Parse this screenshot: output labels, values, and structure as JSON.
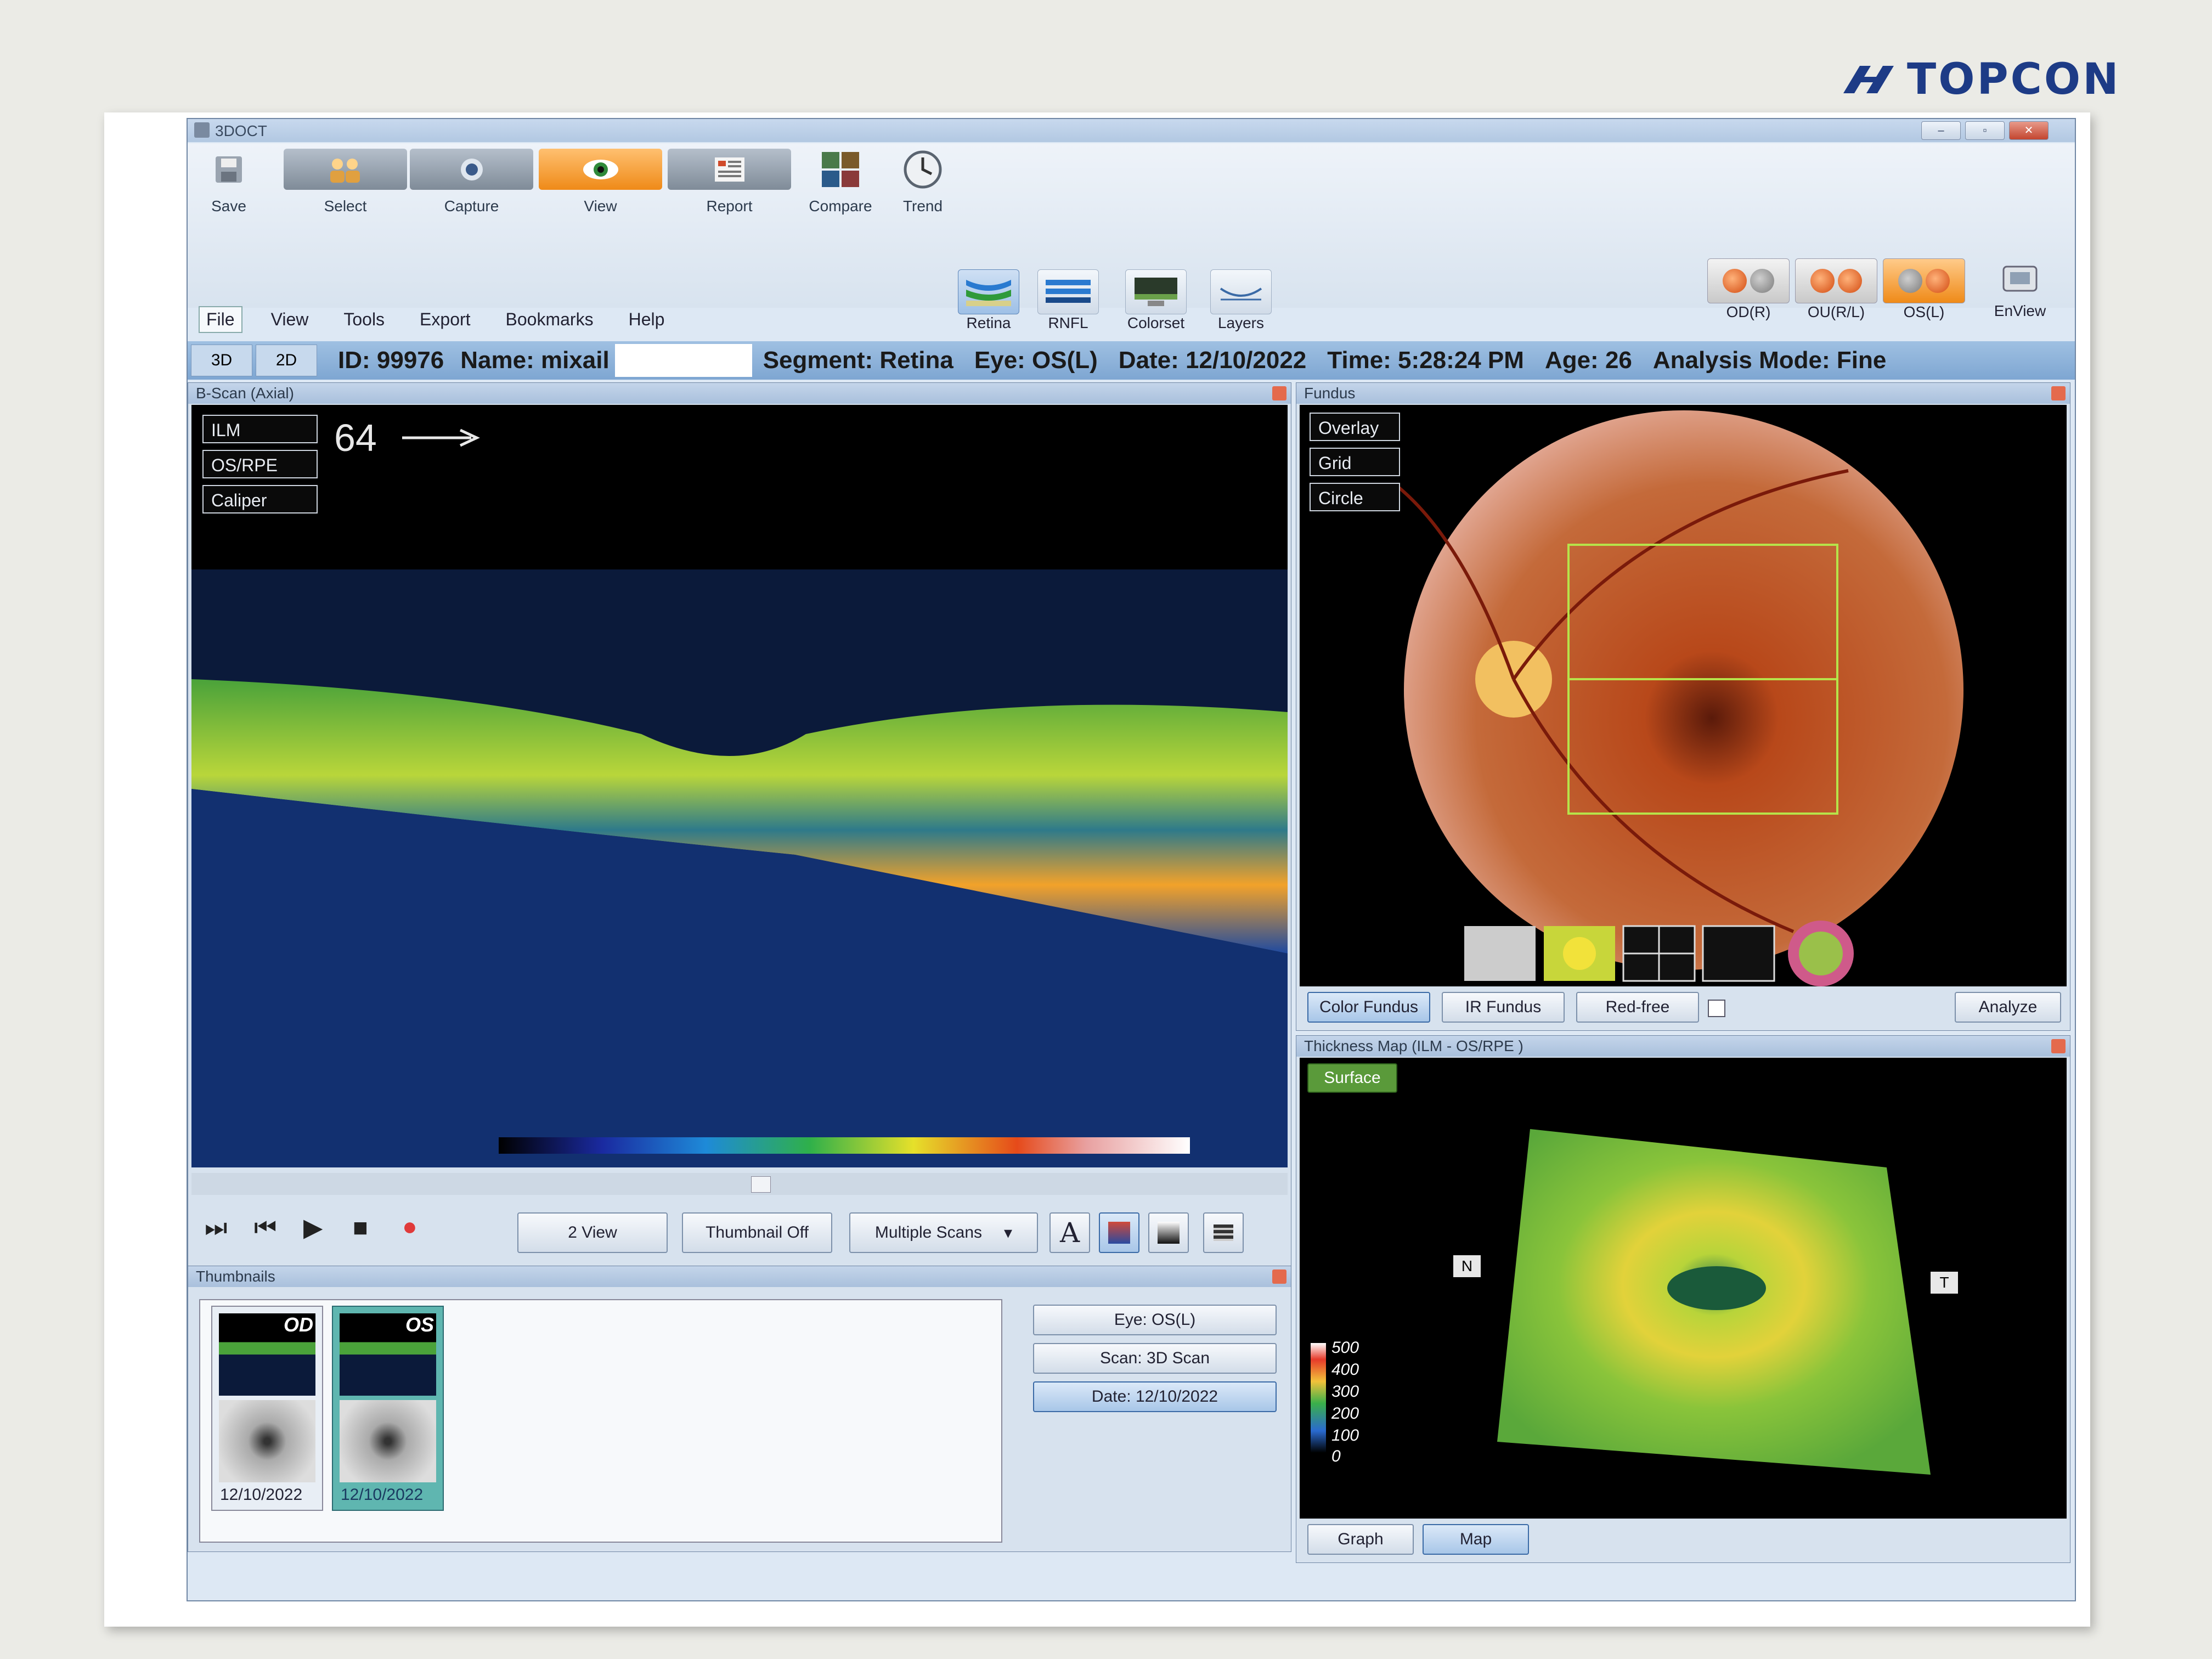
{
  "brand": {
    "name": "TOPCON",
    "color": "#1d3b86"
  },
  "window": {
    "title": "3DOCT",
    "controls": [
      "–",
      "▫",
      "✕"
    ]
  },
  "toolbar": {
    "save": "Save",
    "select": "Select",
    "capture": "Capture",
    "view": "View",
    "report": "Report",
    "compare": "Compare",
    "trend": "Trend"
  },
  "viewbar": {
    "retina": "Retina",
    "rnfl": "RNFL",
    "colorset": "Colorset",
    "layers": "Layers"
  },
  "eyes": {
    "od": "OD(R)",
    "ou": "OU(R/L)",
    "os": "OS(L)",
    "enview": "EnView"
  },
  "menu": [
    "File",
    "View",
    "Tools",
    "Export",
    "Bookmarks",
    "Help"
  ],
  "tabs": {
    "t3d": "3D",
    "t2d": "2D"
  },
  "info": {
    "id": "ID: 99976",
    "name": "Name: mixail",
    "segment": "Segment: Retina",
    "eye": "Eye: OS(L)",
    "date": "Date: 12/10/2022",
    "time": "Time: 5:28:24 PM",
    "age": "Age: 26",
    "mode": "Analysis Mode: Fine"
  },
  "bscan": {
    "title": "B-Scan (Axial)",
    "frame": "64",
    "overlays": [
      "ILM",
      "OS/RPE",
      "Caliper"
    ],
    "view2": "2 View",
    "thumb": "Thumbnail Off",
    "multi": "Multiple Scans",
    "text_tool": "A"
  },
  "thumbnails": {
    "title": "Thumbnails",
    "items": [
      {
        "eye": "OD",
        "date": "12/10/2022"
      },
      {
        "eye": "OS",
        "date": "12/10/2022"
      }
    ],
    "filters": [
      "Eye: OS(L)",
      "Scan: 3D Scan",
      "Date: 12/10/2022"
    ]
  },
  "fundus": {
    "title": "Fundus",
    "overlays": [
      "Overlay",
      "Grid",
      "Circle"
    ],
    "modes": [
      "Color Fundus",
      "IR Fundus",
      "Red-free"
    ],
    "analyze": "Analyze"
  },
  "thickness": {
    "title": "Thickness Map   (ILM - OS/RPE )",
    "surface": "Surface",
    "scale": [
      "500",
      "400",
      "300",
      "200",
      "100",
      "0"
    ],
    "n_label": "N",
    "t_label": "T",
    "graph": "Graph",
    "map": "Map"
  }
}
